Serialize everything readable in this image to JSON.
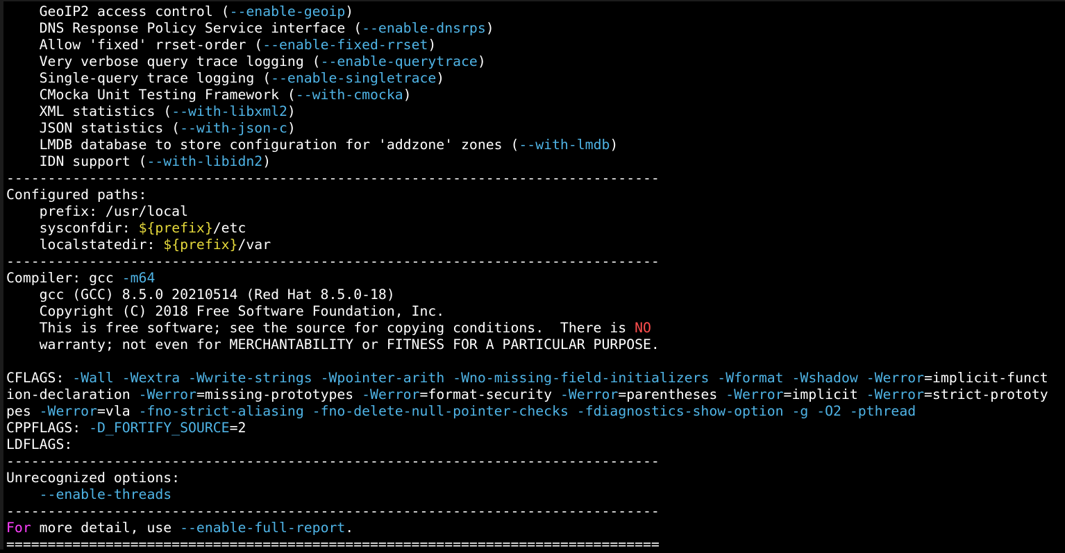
{
  "terminal": {
    "colors": {
      "background": "#000000",
      "default": "#ffffff",
      "cyan": "#4fb4e6",
      "yellow": "#e5d93b",
      "red": "#ff4d4d",
      "magenta": "#ff40ff"
    },
    "lines": [
      [
        [
          "default",
          "    GeoIP2 access control ("
        ],
        [
          "cyan",
          "--enable-geoip"
        ],
        [
          "default",
          ")"
        ]
      ],
      [
        [
          "default",
          "    DNS Response Policy Service interface ("
        ],
        [
          "cyan",
          "--enable-dnsrps"
        ],
        [
          "default",
          ")"
        ]
      ],
      [
        [
          "default",
          "    Allow 'fixed' rrset-order ("
        ],
        [
          "cyan",
          "--enable-fixed-rrset"
        ],
        [
          "default",
          ")"
        ]
      ],
      [
        [
          "default",
          "    Very verbose query trace logging ("
        ],
        [
          "cyan",
          "--enable-querytrace"
        ],
        [
          "default",
          ")"
        ]
      ],
      [
        [
          "default",
          "    Single-query trace logging ("
        ],
        [
          "cyan",
          "--enable-singletrace"
        ],
        [
          "default",
          ")"
        ]
      ],
      [
        [
          "default",
          "    CMocka Unit Testing Framework ("
        ],
        [
          "cyan",
          "--with-cmocka"
        ],
        [
          "default",
          ")"
        ]
      ],
      [
        [
          "default",
          "    XML statistics ("
        ],
        [
          "cyan",
          "--with-libxml2"
        ],
        [
          "default",
          ")"
        ]
      ],
      [
        [
          "default",
          "    JSON statistics ("
        ],
        [
          "cyan",
          "--with-json-c"
        ],
        [
          "default",
          ")"
        ]
      ],
      [
        [
          "default",
          "    LMDB database to store configuration for 'addzone' zones ("
        ],
        [
          "cyan",
          "--with-lmdb"
        ],
        [
          "default",
          ")"
        ]
      ],
      [
        [
          "default",
          "    IDN support ("
        ],
        [
          "cyan",
          "--with-libidn2"
        ],
        [
          "default",
          ")"
        ]
      ],
      [
        [
          "default",
          "-------------------------------------------------------------------------------"
        ]
      ],
      [
        [
          "default",
          "Configured paths:"
        ]
      ],
      [
        [
          "default",
          "    prefix: /usr/local"
        ]
      ],
      [
        [
          "default",
          "    sysconfdir: "
        ],
        [
          "yellow",
          "${prefix}"
        ],
        [
          "default",
          "/etc"
        ]
      ],
      [
        [
          "default",
          "    localstatedir: "
        ],
        [
          "yellow",
          "${prefix}"
        ],
        [
          "default",
          "/var"
        ]
      ],
      [
        [
          "default",
          "-------------------------------------------------------------------------------"
        ]
      ],
      [
        [
          "default",
          "Compiler: gcc "
        ],
        [
          "cyan",
          "-m64"
        ]
      ],
      [
        [
          "default",
          "    gcc (GCC) 8.5.0 20210514 (Red Hat 8.5.0-18)"
        ]
      ],
      [
        [
          "default",
          "    Copyright (C) 2018 Free Software Foundation, Inc."
        ]
      ],
      [
        [
          "default",
          "    This is free software; see the source for copying conditions.  There is "
        ],
        [
          "red",
          "NO"
        ]
      ],
      [
        [
          "default",
          "    warranty; not even for MERCHANTABILITY or FITNESS FOR A PARTICULAR PURPOSE."
        ]
      ],
      [
        [
          "default",
          ""
        ]
      ],
      [
        [
          "default",
          "CFLAGS: "
        ],
        [
          "cyan",
          "-Wall"
        ],
        [
          "default",
          " "
        ],
        [
          "cyan",
          "-Wextra"
        ],
        [
          "default",
          " "
        ],
        [
          "cyan",
          "-Wwrite-strings"
        ],
        [
          "default",
          " "
        ],
        [
          "cyan",
          "-Wpointer-arith"
        ],
        [
          "default",
          " "
        ],
        [
          "cyan",
          "-Wno-missing-field-initializers"
        ],
        [
          "default",
          " "
        ],
        [
          "cyan",
          "-Wformat"
        ],
        [
          "default",
          " "
        ],
        [
          "cyan",
          "-Wshadow"
        ],
        [
          "default",
          " "
        ],
        [
          "cyan",
          "-Werror"
        ],
        [
          "default",
          "=implicit-funct"
        ]
      ],
      [
        [
          "default",
          "ion-declaration "
        ],
        [
          "cyan",
          "-Werror"
        ],
        [
          "default",
          "=missing-prototypes "
        ],
        [
          "cyan",
          "-Werror"
        ],
        [
          "default",
          "=format-security "
        ],
        [
          "cyan",
          "-Werror"
        ],
        [
          "default",
          "=parentheses "
        ],
        [
          "cyan",
          "-Werror"
        ],
        [
          "default",
          "=implicit "
        ],
        [
          "cyan",
          "-Werror"
        ],
        [
          "default",
          "=strict-prototy"
        ]
      ],
      [
        [
          "default",
          "pes "
        ],
        [
          "cyan",
          "-Werror"
        ],
        [
          "default",
          "=vla "
        ],
        [
          "cyan",
          "-fno-strict-aliasing"
        ],
        [
          "default",
          " "
        ],
        [
          "cyan",
          "-fno-delete-null-pointer-checks"
        ],
        [
          "default",
          " "
        ],
        [
          "cyan",
          "-fdiagnostics-show-option"
        ],
        [
          "default",
          " "
        ],
        [
          "cyan",
          "-g"
        ],
        [
          "default",
          " "
        ],
        [
          "cyan",
          "-O2"
        ],
        [
          "default",
          " "
        ],
        [
          "cyan",
          "-pthread"
        ]
      ],
      [
        [
          "default",
          "CPPFLAGS: "
        ],
        [
          "cyan",
          "-D_FORTIFY_SOURCE"
        ],
        [
          "default",
          "=2"
        ]
      ],
      [
        [
          "default",
          "LDFLAGS:"
        ]
      ],
      [
        [
          "default",
          "-------------------------------------------------------------------------------"
        ]
      ],
      [
        [
          "default",
          "Unrecognized options:"
        ]
      ],
      [
        [
          "cyan",
          "    --enable-threads"
        ]
      ],
      [
        [
          "default",
          "-------------------------------------------------------------------------------"
        ]
      ],
      [
        [
          "magenta",
          "For"
        ],
        [
          "default",
          " more detail, use "
        ],
        [
          "cyan",
          "--enable-full-report"
        ],
        [
          "default",
          "."
        ]
      ],
      [
        [
          "default",
          "==============================================================================="
        ]
      ]
    ]
  }
}
